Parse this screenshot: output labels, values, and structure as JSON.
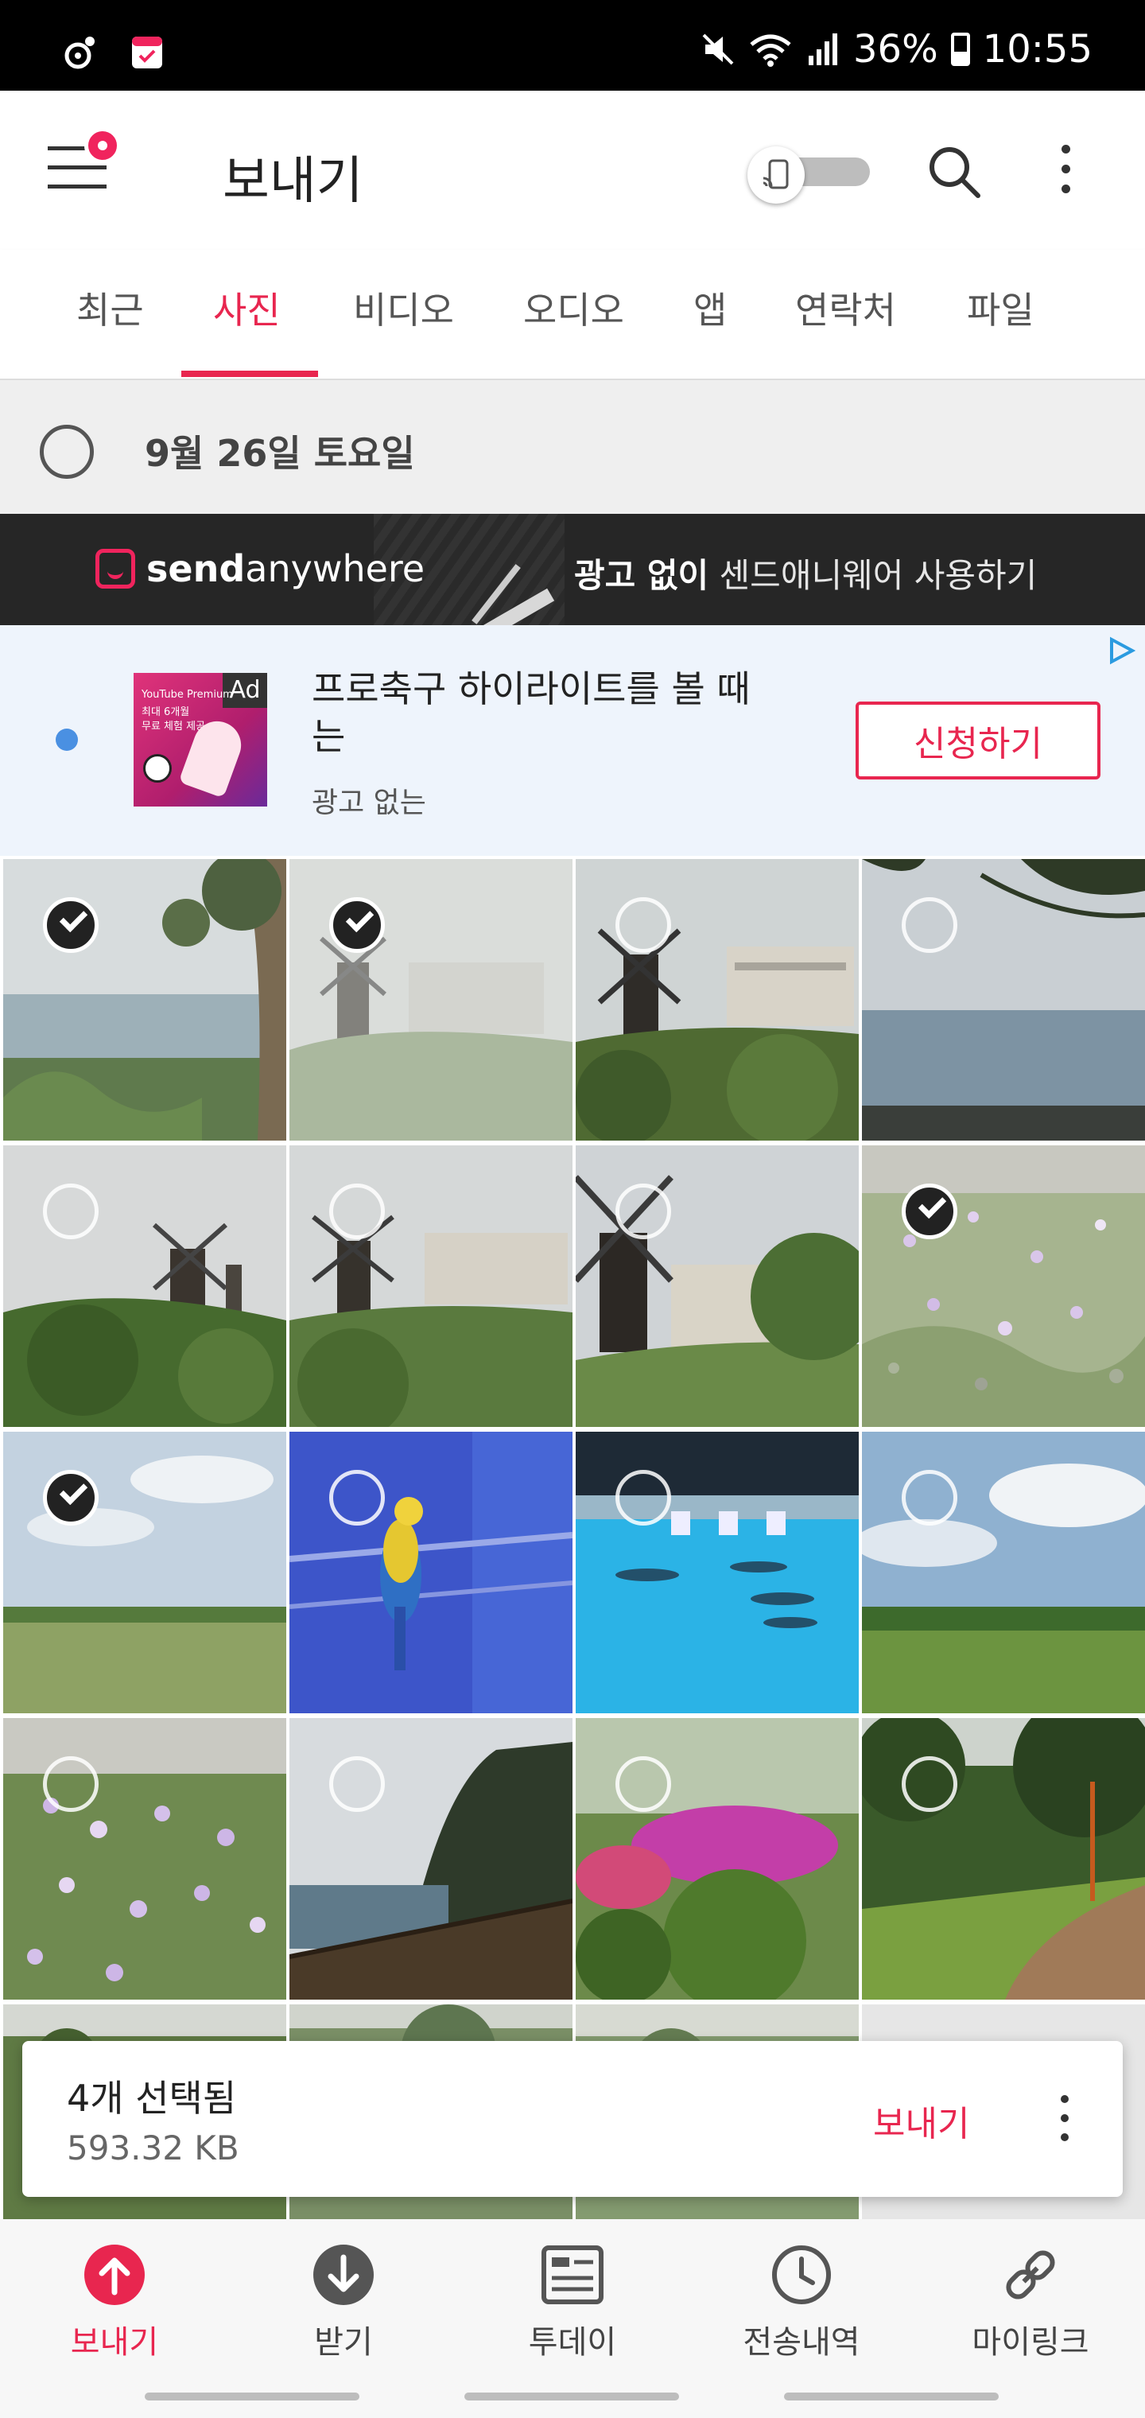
{
  "status_bar": {
    "battery": "36%",
    "time": "10:55",
    "icons": [
      "notification-dot-icon",
      "calendar-icon",
      "mute-icon",
      "wifi-icon",
      "signal-icon",
      "battery-icon"
    ]
  },
  "app_bar": {
    "title": "보내기",
    "icons": [
      "menu-icon",
      "cast-toggle-icon",
      "search-icon",
      "more-vert-icon"
    ]
  },
  "tabs": [
    {
      "label": "최근",
      "active": false
    },
    {
      "label": "사진",
      "active": true
    },
    {
      "label": "비디오",
      "active": false
    },
    {
      "label": "오디오",
      "active": false
    },
    {
      "label": "앱",
      "active": false
    },
    {
      "label": "연락처",
      "active": false
    },
    {
      "label": "파일",
      "active": false
    }
  ],
  "date_header": {
    "label": "9월 26일 토요일"
  },
  "banner": {
    "brand_a": "send",
    "brand_b": "anywhere",
    "text_bold": "광고 없이",
    "text_rest": " 센드애니웨어 사용하기"
  },
  "ad": {
    "title": "프로축구 하이라이트를 볼 때는",
    "subtitle": "광고 없는",
    "cta": "신청하기",
    "image_tag": "Ad",
    "image_line1": "YouTube Premium",
    "image_line2": "최대 6개월",
    "image_line3": "무료 체험 제공"
  },
  "photos": [
    {
      "scene": "sea-tree",
      "checked": true
    },
    {
      "scene": "windmill-hotel-fog",
      "checked": true
    },
    {
      "scene": "windmill-hotel",
      "checked": false
    },
    {
      "scene": "sea-branches",
      "checked": false
    },
    {
      "scene": "windmills-hill",
      "checked": false
    },
    {
      "scene": "windmill-hotel-wide",
      "checked": false
    },
    {
      "scene": "windmill-close",
      "checked": false
    },
    {
      "scene": "wildflowers",
      "checked": true
    },
    {
      "scene": "meadow-sky",
      "checked": true
    },
    {
      "scene": "parrot",
      "checked": false
    },
    {
      "scene": "dolphin-pool",
      "checked": false
    },
    {
      "scene": "meadow-clouds",
      "checked": false
    },
    {
      "scene": "wildflowers-2",
      "checked": false
    },
    {
      "scene": "cliff-coast",
      "checked": false
    },
    {
      "scene": "azaleas",
      "checked": false
    },
    {
      "scene": "park-path",
      "checked": false
    }
  ],
  "selection": {
    "count_label": "4개 선택됨",
    "size_label": "593.32 KB",
    "send_label": "보내기"
  },
  "bottom_nav": [
    {
      "label": "보내기",
      "icon": "upload-arrow-icon",
      "active": true
    },
    {
      "label": "받기",
      "icon": "download-arrow-icon",
      "active": false
    },
    {
      "label": "투데이",
      "icon": "newspaper-icon",
      "active": false
    },
    {
      "label": "전송내역",
      "icon": "history-clock-icon",
      "active": false
    },
    {
      "label": "마이링크",
      "icon": "link-icon",
      "active": false
    }
  ],
  "colors": {
    "accent": "#e8264f",
    "banner_bg": "#262626",
    "ad_bg": "#eef4fc"
  }
}
